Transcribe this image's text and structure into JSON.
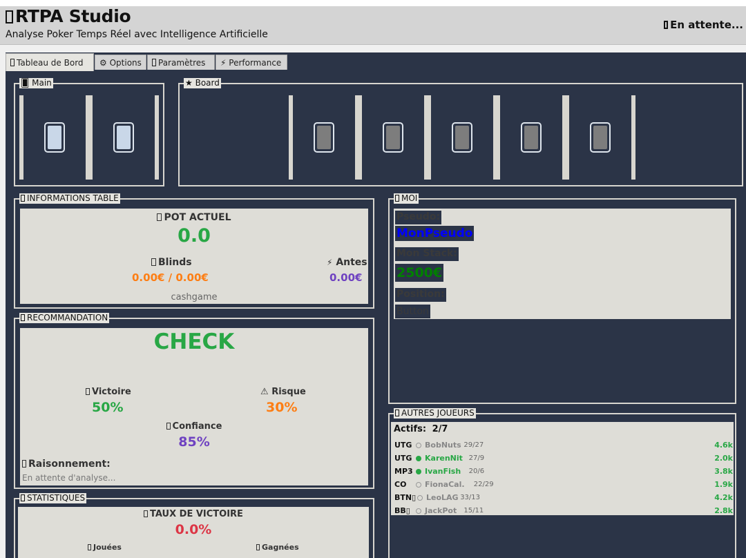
{
  "header": {
    "title_icon": "?",
    "title": "RTPA Studio",
    "subtitle": "Analyse Poker Temps Réel avec Intelligence Artificielle",
    "status_icon": "?",
    "status": "En attente..."
  },
  "tabs": [
    {
      "icon": "▯",
      "label": "Tableau de Bord",
      "active": true
    },
    {
      "icon": "⚙",
      "label": "Options"
    },
    {
      "icon": "▯",
      "label": "Paramètres"
    },
    {
      "icon": "⚡",
      "label": "Performance"
    }
  ],
  "hand": {
    "icon": "🂠",
    "label": "Main",
    "cards": [
      "card-back",
      "card-back"
    ]
  },
  "board": {
    "icon": "★",
    "label": "Board",
    "cards": [
      "card-back",
      "card-back",
      "card-back",
      "card-back",
      "card-back"
    ]
  },
  "table_info": {
    "label": "INFORMATIONS TABLE",
    "pot_label": "POT ACTUEL",
    "pot_value": "0.0",
    "blinds_label": "Blinds",
    "blinds_value": "0.00€ / 0.00€",
    "antes_label": "Antes",
    "antes_value": "0.00€",
    "game_type": "cashgame"
  },
  "recommendation": {
    "label": "RECOMMANDATION",
    "action": "CHECK",
    "victory_label": "Victoire",
    "victory_value": "50%",
    "risk_label": "Risque",
    "risk_value": "30%",
    "confidence_label": "Confiance",
    "confidence_value": "85%",
    "reasoning_label": "Raisonnement:",
    "reasoning_text": "En attente d'analyse..."
  },
  "statistics": {
    "label": "STATISTIQUES",
    "win_rate_label": "TAUX DE VICTOIRE",
    "win_rate_value": "0.0%",
    "played_label": "Jouées",
    "won_label": "Gagnées"
  },
  "me": {
    "label": "MOI",
    "pseudo_label": "Pseudo:",
    "pseudo_value": "MonPseudo",
    "stack_label": "Mon Stack:",
    "stack_value": "2500€",
    "position_label": "Position:",
    "position_value": "Button"
  },
  "others": {
    "label": "AUTRES JOUEURS",
    "active_label": "Actifs:",
    "active_value": "2/7",
    "players": [
      {
        "pos": "UTG",
        "active": false,
        "name": "BobNuts",
        "stats": "29/27",
        "stack": "4.6k"
      },
      {
        "pos": "UTG",
        "active": true,
        "name": "KarenNit",
        "stats": "27/9",
        "stack": "2.0k"
      },
      {
        "pos": "MP3",
        "active": true,
        "name": "IvanFish",
        "stats": "20/6",
        "stack": "3.8k"
      },
      {
        "pos": "CO",
        "active": false,
        "name": "FionaCal.",
        "stats": "22/29",
        "stack": "1.9k"
      },
      {
        "pos": "BTN▯",
        "active": false,
        "name": "LeoLAG",
        "stats": "33/13",
        "stack": "4.2k"
      },
      {
        "pos": "BB▯",
        "active": false,
        "name": "JackPot",
        "stats": "15/11",
        "stack": "2.8k"
      }
    ]
  },
  "colors": {
    "bg_dark": "#2b3447",
    "panel": "#deddd7",
    "green": "#28a745",
    "orange": "#fd7e14",
    "purple": "#6f42c1",
    "red": "#dc3545",
    "blue": "#0000ff",
    "dark_green": "#008000"
  }
}
